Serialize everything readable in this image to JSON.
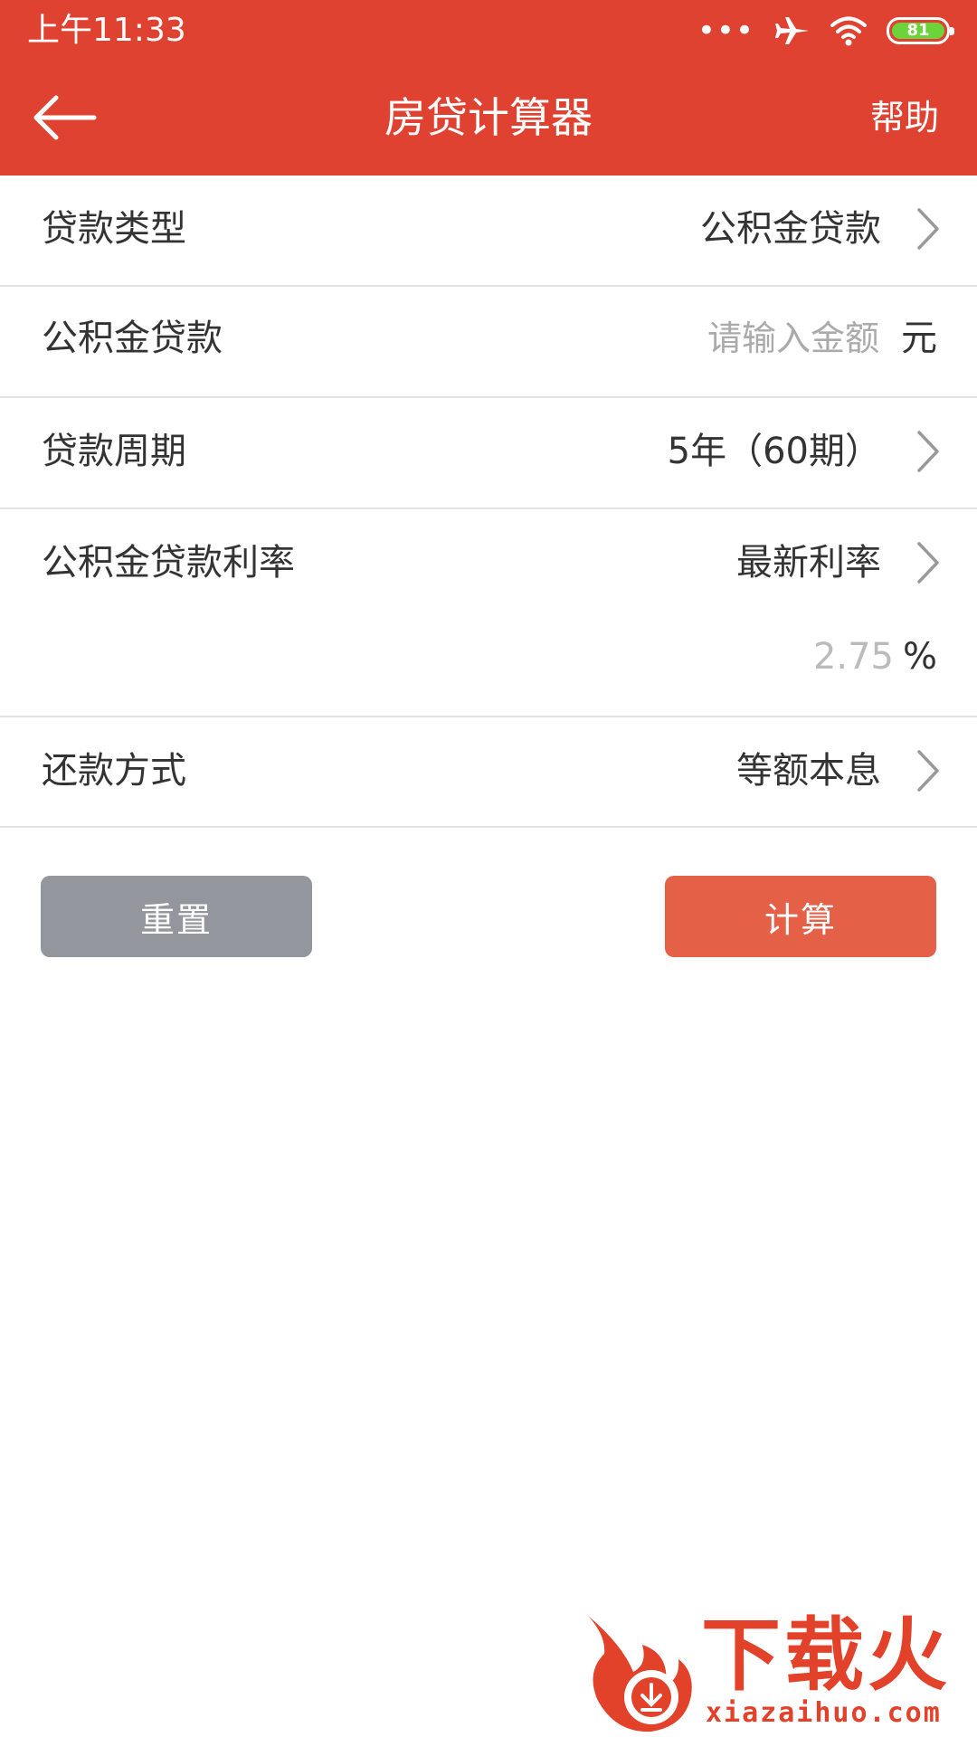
{
  "status_bar": {
    "time": "上午11:33",
    "signal_dots": "•••",
    "battery_level": "81",
    "battery_color": "#6cd33a"
  },
  "header": {
    "title": "房贷计算器",
    "help_label": "帮助",
    "background_color": "#df4230"
  },
  "form": {
    "loan_type": {
      "label": "贷款类型",
      "value": "公积金贷款"
    },
    "loan_amount": {
      "label": "公积金贷款",
      "placeholder": "请输入金额",
      "unit": "元"
    },
    "loan_period": {
      "label": "贷款周期",
      "value": "5年（60期）"
    },
    "loan_rate": {
      "label": "公积金贷款利率",
      "value": "最新利率",
      "rate_placeholder": "2.75",
      "unit": "%"
    },
    "repayment": {
      "label": "还款方式",
      "value": "等额本息"
    }
  },
  "buttons": {
    "reset_label": "重置",
    "calculate_label": "计算",
    "reset_color": "#93969c",
    "calculate_color": "#e46047"
  },
  "watermark": {
    "brand": "下载火",
    "url": "xiazaihuo.com"
  }
}
